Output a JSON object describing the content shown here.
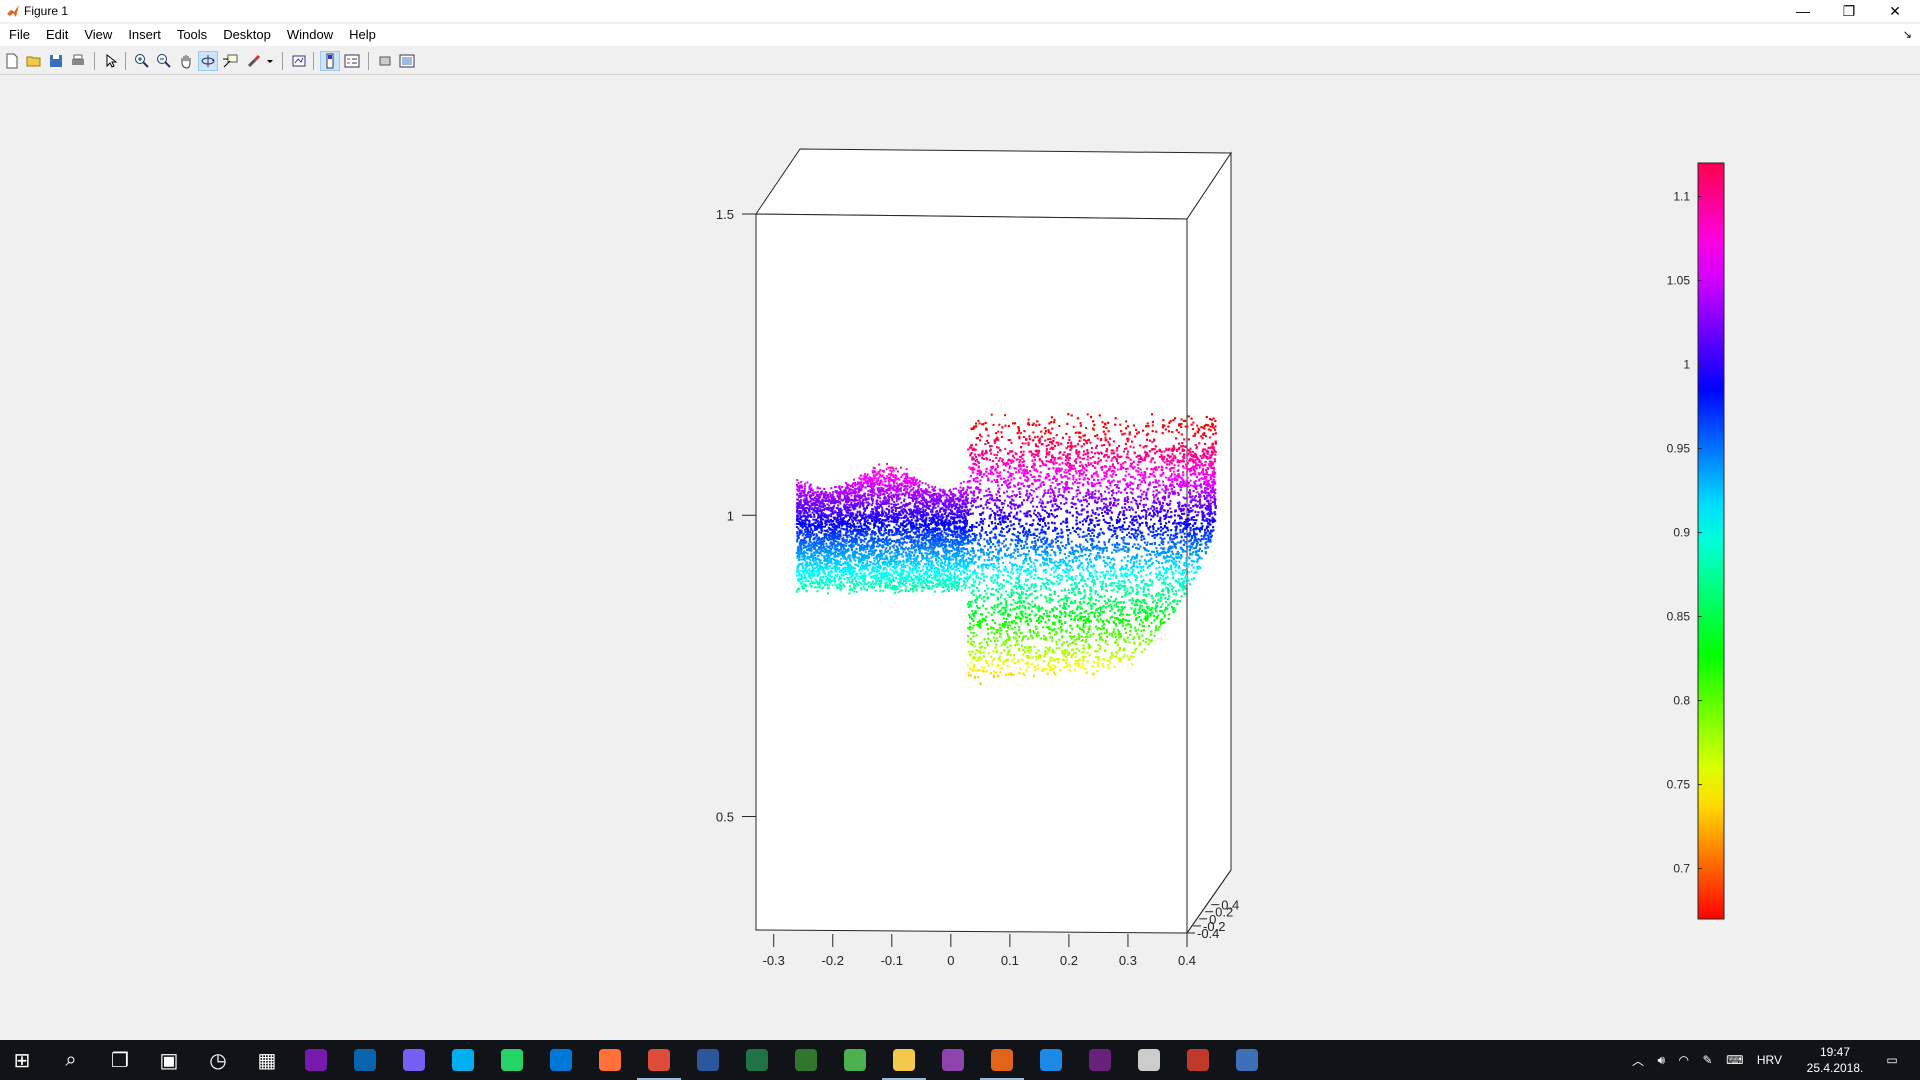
{
  "window": {
    "title": "Figure 1",
    "minimize_glyph": "—",
    "restore_glyph": "❐",
    "close_glyph": "✕"
  },
  "menu": {
    "items": [
      "File",
      "Edit",
      "View",
      "Insert",
      "Tools",
      "Desktop",
      "Window",
      "Help"
    ],
    "dock_glyph": "↘"
  },
  "toolbar": {
    "icons": [
      "new-figure-icon",
      "open-file-icon",
      "save-icon",
      "print-icon",
      "edit-plot-icon",
      "zoom-in-icon",
      "zoom-out-icon",
      "pan-icon",
      "rotate-3d-icon",
      "data-cursor-icon",
      "brush-icon",
      "link-plot-icon",
      "colorbar-icon",
      "legend-icon",
      "hide-plot-tools-icon",
      "show-plot-tools-icon"
    ]
  },
  "chart_data": {
    "type": "scatter",
    "title": "",
    "xlabel": "",
    "ylabel": "",
    "zlabel": "",
    "xlim": [
      -0.33,
      0.4
    ],
    "ylim": [
      -0.4,
      0.4
    ],
    "zlim": [
      0.31,
      1.5
    ],
    "x_ticks": [
      "-0.3",
      "-0.2",
      "-0.1",
      "0",
      "0.1",
      "0.2",
      "0.3",
      "0.4"
    ],
    "y_ticks": [
      "-0.4",
      "-0.2",
      "0",
      "0.2",
      "0.4"
    ],
    "z_ticks": [
      "0.5",
      "1",
      "1.5"
    ],
    "colormap": "hsv",
    "color_range": [
      0.67,
      1.12
    ],
    "colorbar_ticks": [
      "0.7",
      "0.75",
      "0.8",
      "0.85",
      "0.9",
      "0.95",
      "1",
      "1.05",
      "1.1"
    ],
    "point_cloud_regions": [
      {
        "x_range": [
          -0.3,
          -0.01
        ],
        "z_top": 1.06,
        "z_bottom_left": 0.88,
        "z_bottom_right": 0.88
      },
      {
        "x_range": [
          -0.01,
          0.41
        ],
        "z_top": 1.16,
        "z_bottom_left": 0.73,
        "z_bottom_right": 0.76
      }
    ]
  },
  "taskbar": {
    "apps": [
      "windows-start-icon",
      "search-icon",
      "task-view-icon",
      "store-icon",
      "clock-app-icon",
      "calculator-icon",
      "onenote-icon",
      "outlook-icon",
      "viber-icon",
      "skype-icon",
      "whatsapp-icon",
      "edge-icon",
      "firefox-icon",
      "chrome-icon",
      "word-icon",
      "excel-icon",
      "project-icon",
      "network-app-icon",
      "file-explorer-icon",
      "media-app-icon",
      "matlab-icon",
      "maps-icon",
      "visual-studio-icon",
      "tools-icon",
      "ide-icon",
      "remote-desktop-icon"
    ],
    "language": "HRV",
    "time": "19:47",
    "date": "25.4.2018."
  }
}
